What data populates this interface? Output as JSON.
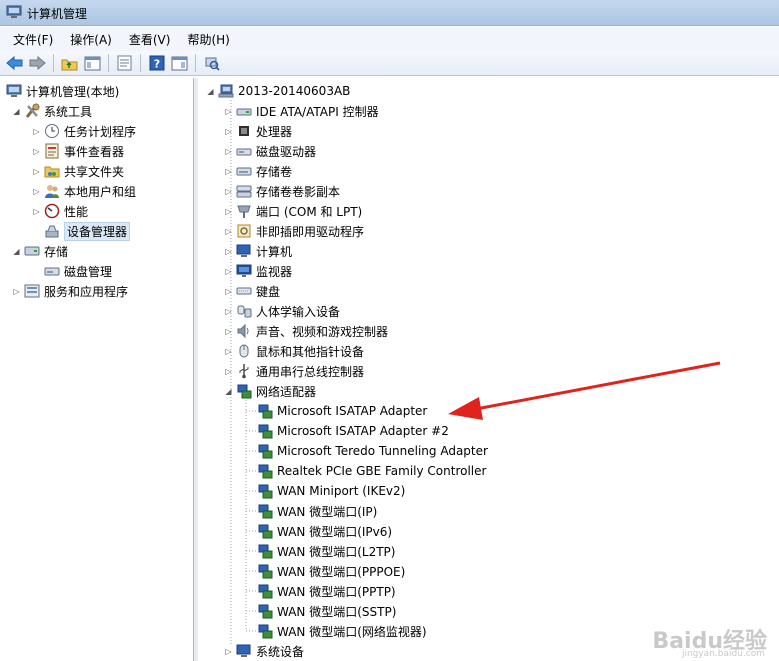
{
  "window": {
    "title": "计算机管理"
  },
  "menu": [
    "文件(F)",
    "操作(A)",
    "查看(V)",
    "帮助(H)"
  ],
  "left_tree": {
    "root": "计算机管理(本地)",
    "system_tools": "系统工具",
    "system_children": [
      "任务计划程序",
      "事件查看器",
      "共享文件夹",
      "本地用户和组",
      "性能",
      "设备管理器"
    ],
    "storage": "存储",
    "storage_children": [
      "磁盘管理"
    ],
    "services": "服务和应用程序"
  },
  "device_tree": {
    "computer_name": "2013-20140603AB",
    "categories": [
      "IDE ATA/ATAPI 控制器",
      "处理器",
      "磁盘驱动器",
      "存储卷",
      "存储卷卷影副本",
      "端口 (COM 和 LPT)",
      "非即插即用驱动程序",
      "计算机",
      "监视器",
      "键盘",
      "人体学输入设备",
      "声音、视频和游戏控制器",
      "鼠标和其他指针设备",
      "通用串行总线控制器",
      "网络适配器"
    ],
    "network_adapters": [
      "Microsoft ISATAP Adapter",
      "Microsoft ISATAP Adapter #2",
      "Microsoft Teredo Tunneling Adapter",
      "Realtek PCIe GBE Family Controller",
      "WAN Miniport (IKEv2)",
      "WAN 微型端口(IP)",
      "WAN 微型端口(IPv6)",
      "WAN 微型端口(L2TP)",
      "WAN 微型端口(PPPOE)",
      "WAN 微型端口(PPTP)",
      "WAN 微型端口(SSTP)",
      "WAN 微型端口(网络监视器)"
    ],
    "last_category": "系统设备"
  },
  "watermark": {
    "text": "Baidu经验",
    "sub": "jingyan.baidu.com"
  },
  "colors": {
    "arrow": "#e0231c",
    "selection": "#dde8f6"
  }
}
